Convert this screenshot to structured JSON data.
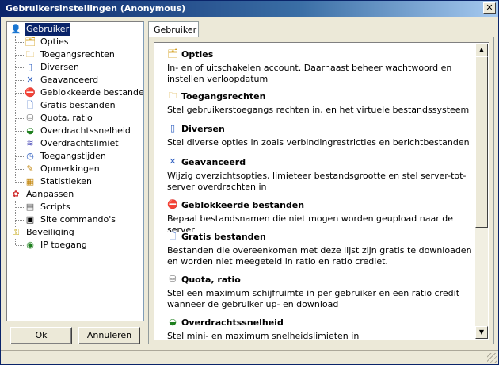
{
  "window": {
    "title": "Gebruikersinstellingen (Anonymous)",
    "close_label": "✕"
  },
  "tree": {
    "items": [
      {
        "label": "Gebruiker",
        "icon": "user-icon",
        "glyph": "👤",
        "color": "#c08000"
      },
      {
        "label": "Opties",
        "icon": "options-folder-icon",
        "glyph": "🗂",
        "color": "#d4a020"
      },
      {
        "label": "Toegangsrechten",
        "icon": "access-folder-icon",
        "glyph": "🗀",
        "color": "#d4a020"
      },
      {
        "label": "Diversen",
        "icon": "misc-icon",
        "glyph": "▯",
        "color": "#3060c0"
      },
      {
        "label": "Geavanceerd",
        "icon": "tools-icon",
        "glyph": "✕",
        "color": "#3060c0"
      },
      {
        "label": "Geblokkeerde bestanden",
        "icon": "blocked-file-icon",
        "glyph": "⛔",
        "color": "#c00000"
      },
      {
        "label": "Gratis bestanden",
        "icon": "free-file-icon",
        "glyph": "🗋",
        "color": "#3060c0"
      },
      {
        "label": "Quota, ratio",
        "icon": "quota-icon",
        "glyph": "⛁",
        "color": "#808080"
      },
      {
        "label": "Overdrachtssnelheid",
        "icon": "speed-icon",
        "glyph": "◒",
        "color": "#208020"
      },
      {
        "label": "Overdrachtslimiet",
        "icon": "limit-icon",
        "glyph": "≋",
        "color": "#6060c0"
      },
      {
        "label": "Toegangstijden",
        "icon": "clock-icon",
        "glyph": "◷",
        "color": "#3060c0"
      },
      {
        "label": "Opmerkingen",
        "icon": "notes-icon",
        "glyph": "✎",
        "color": "#c08000"
      },
      {
        "label": "Statistieken",
        "icon": "stats-icon",
        "glyph": "▦",
        "color": "#c08000"
      },
      {
        "label": "Aanpassen",
        "icon": "customize-icon",
        "glyph": "✿",
        "color": "#d03030"
      },
      {
        "label": "Scripts",
        "icon": "scripts-icon",
        "glyph": "▤",
        "color": "#606060"
      },
      {
        "label": "Site commando's",
        "icon": "console-icon",
        "glyph": "▣",
        "color": "#000000"
      },
      {
        "label": "Beveiliging",
        "icon": "security-icon",
        "glyph": "⚿",
        "color": "#c0a000"
      },
      {
        "label": "IP toegang",
        "icon": "ip-access-icon",
        "glyph": "◉",
        "color": "#208020"
      }
    ]
  },
  "buttons": {
    "ok": "Ok",
    "cancel": "Annuleren"
  },
  "tab": {
    "label": "Gebruiker"
  },
  "sections": [
    {
      "title": "Opties",
      "icon": "options-folder-icon",
      "glyph": "🗂",
      "color": "#d4a020",
      "desc": "In- en of uitschakelen account. Daarnaast beheer wachtwoord en instellen verloopdatum"
    },
    {
      "title": "Toegangsrechten",
      "icon": "access-folder-icon",
      "glyph": "🗀",
      "color": "#d4a020",
      "desc": "Stel gebruikerstoegangs rechten in, en het virtuele bestandssysteem"
    },
    {
      "title": "Diversen",
      "icon": "misc-icon",
      "glyph": "▯",
      "color": "#3060c0",
      "desc": "Stel diverse opties in zoals verbindingrestricties en berichtbestanden"
    },
    {
      "title": "Geavanceerd",
      "icon": "tools-icon",
      "glyph": "✕",
      "color": "#3060c0",
      "desc": "Wijzig overzichtsopties, limieteer bestandsgrootte en stel server-tot-server overdrachten in"
    },
    {
      "title": "Geblokkeerde bestanden",
      "icon": "blocked-file-icon",
      "glyph": "⛔",
      "color": "#c00000",
      "desc": "Bepaal bestandsnamen die niet mogen worden geupload naar de server"
    },
    {
      "title": "Gratis bestanden",
      "icon": "free-file-icon",
      "glyph": "🗋",
      "color": "#3060c0",
      "desc": "Bestanden die overeenkomen met deze lijst zijn gratis te downloaden en worden niet meegeteld in ratio en ratio crediet."
    },
    {
      "title": "Quota, ratio",
      "icon": "quota-icon",
      "glyph": "⛁",
      "color": "#808080",
      "desc": "Stel een maximum schijfruimte in per gebruiker en een ratio credit wanneer de gebruiker up- en download"
    },
    {
      "title": "Overdrachtssnelheid",
      "icon": "speed-icon",
      "glyph": "◒",
      "color": "#208020",
      "desc": "Stel mini- en maximum snelheidslimieten in"
    }
  ],
  "scrollbar": {
    "up": "▲",
    "down": "▼"
  }
}
